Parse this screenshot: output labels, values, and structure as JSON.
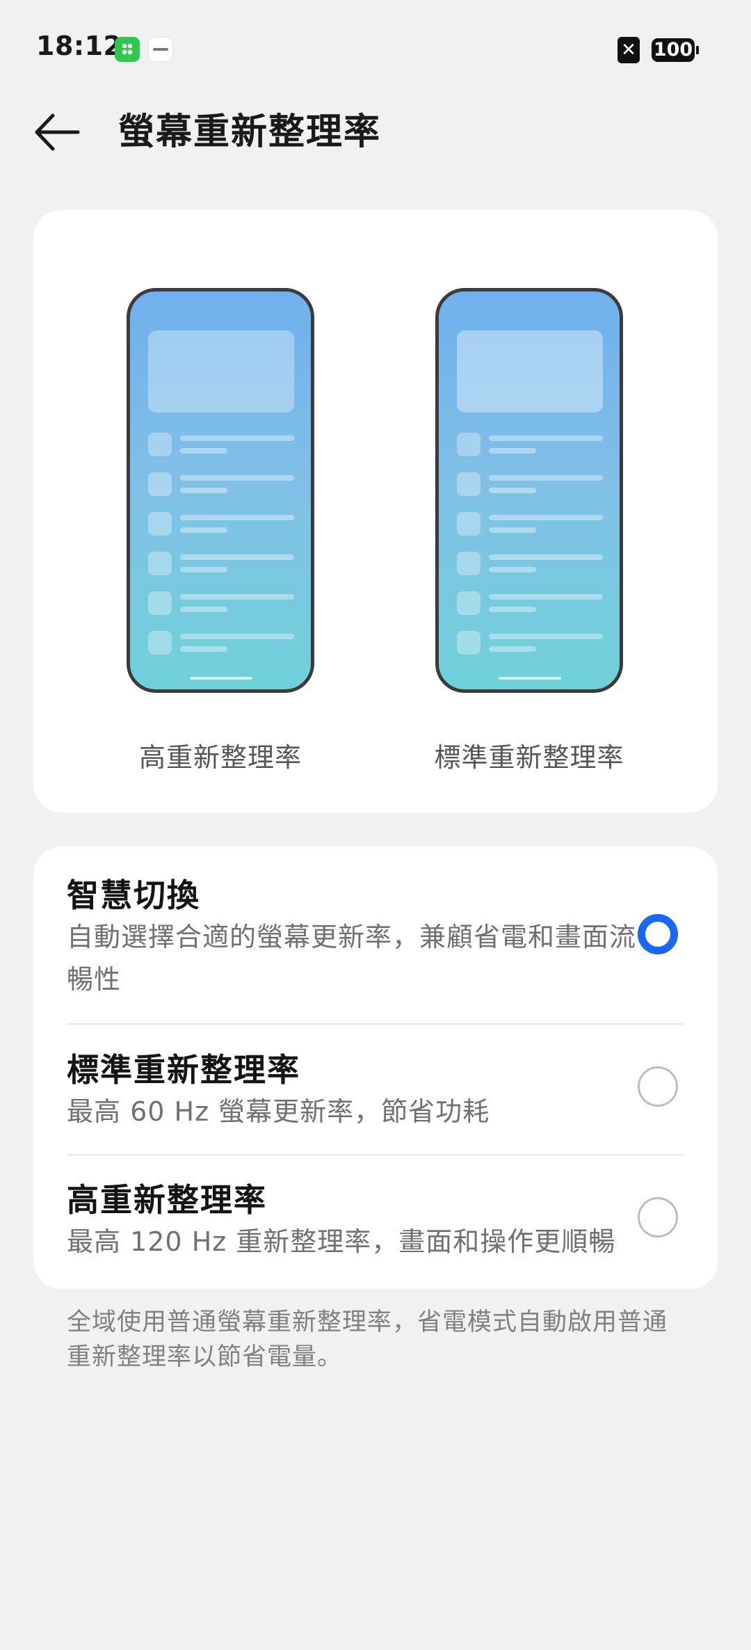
{
  "status_bar": {
    "time": "18:12",
    "battery": "100",
    "notification_x": "✕",
    "icons": [
      "green-app-icon",
      "white-app-icon",
      "close-notification-icon",
      "battery-icon"
    ]
  },
  "header": {
    "title": "螢幕重新整理率",
    "back_icon": "arrow-left-icon"
  },
  "preview": {
    "left_label": "高重新整理率",
    "right_label": "標準重新整理率"
  },
  "options": [
    {
      "title": "智慧切換",
      "description": "自動選擇合適的螢幕更新率，兼顧省電和畫面流暢性",
      "selected": true
    },
    {
      "title": "標準重新整理率",
      "description": "最高 60 Hz 螢幕更新率，節省功耗",
      "selected": false
    },
    {
      "title": "高重新整理率",
      "description": "最高 120 Hz 重新整理率，畫面和操作更順暢",
      "selected": false
    }
  ],
  "footer_note": "全域使用普通螢幕重新整理率，省電模式自動啟用普通重新整理率以節省電量。",
  "colors": {
    "accent": "#1769f5",
    "background": "#f0f1f3",
    "card": "#ffffff"
  }
}
